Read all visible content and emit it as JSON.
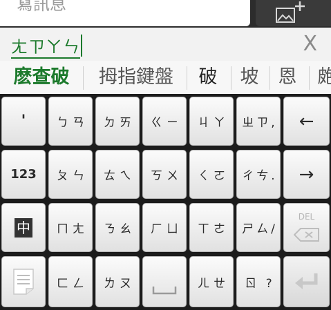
{
  "top": {
    "message_placeholder": "寫訊息"
  },
  "compose": {
    "text": "ㄤㄗㄚㄣ",
    "clear_label": "X"
  },
  "candidates": [
    "麽查破",
    "拇指鍵盤",
    "破",
    "坡",
    "恩",
    "皰"
  ],
  "keys": {
    "row1": [
      "'",
      "ㄅㄢ",
      "ㄉㄞ",
      "ㄍㄧ",
      "ㄐㄚ",
      "ㄓㄗ,",
      "←"
    ],
    "row2": [
      "123",
      "ㄆㄣ",
      "ㄊㄟ",
      "ㄎㄨ",
      "ㄑㄛ",
      "ㄔㄘ.",
      "→"
    ],
    "row3": [
      "中",
      "ㄇㄤ",
      "ㄋㄠ",
      "ㄏㄩ",
      "ㄒㄜ",
      "ㄕㄙ/",
      "DEL"
    ],
    "row4": [
      "ㄈㄥ",
      "ㄌㄡ",
      "ㄦㄝ",
      "ㄖ ?"
    ]
  },
  "colors": {
    "accent": "#1c7a2c",
    "key_bg": "#f0f0f0",
    "keyboard_bg": "#1c1c1c"
  }
}
